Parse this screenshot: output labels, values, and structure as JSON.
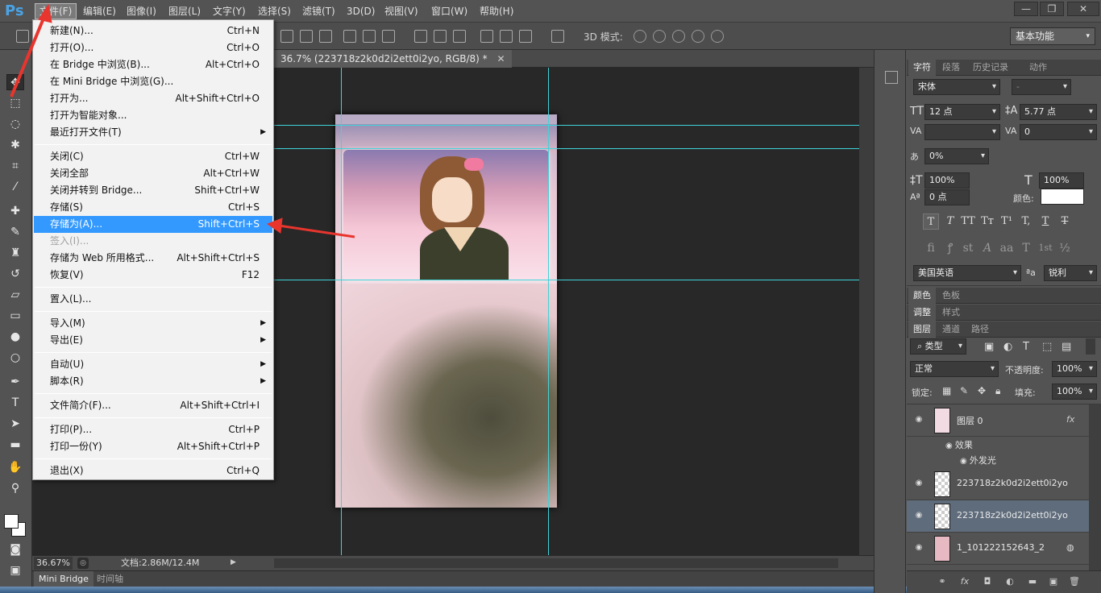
{
  "app": {
    "logo": "Ps"
  },
  "menubar": {
    "items": [
      "文件(F)",
      "编辑(E)",
      "图像(I)",
      "图层(L)",
      "文字(Y)",
      "选择(S)",
      "滤镜(T)",
      "3D(D)",
      "视图(V)",
      "窗口(W)",
      "帮助(H)"
    ],
    "window_buttons": [
      "—",
      "❐",
      "✕"
    ]
  },
  "options": {
    "label_3d": "3D 模式:",
    "workspace": "基本功能"
  },
  "document": {
    "tab_title": "36.7% (223718z2k0d2i2ett0i2yo, RGB/8) *",
    "close": "✕"
  },
  "status": {
    "zoom": "36.67%",
    "doc_size": "文档:2.86M/12.4M"
  },
  "bottom_tabs": [
    "Mini Bridge",
    "时间轴"
  ],
  "file_menu": {
    "groups": [
      [
        {
          "label": "新建(N)...",
          "shortcut": "Ctrl+N"
        },
        {
          "label": "打开(O)...",
          "shortcut": "Ctrl+O"
        },
        {
          "label": "在 Bridge 中浏览(B)...",
          "shortcut": "Alt+Ctrl+O"
        },
        {
          "label": "在 Mini Bridge 中浏览(G)...",
          "shortcut": ""
        },
        {
          "label": "打开为...",
          "shortcut": "Alt+Shift+Ctrl+O"
        },
        {
          "label": "打开为智能对象...",
          "shortcut": ""
        },
        {
          "label": "最近打开文件(T)",
          "shortcut": "",
          "submenu": true
        }
      ],
      [
        {
          "label": "关闭(C)",
          "shortcut": "Ctrl+W"
        },
        {
          "label": "关闭全部",
          "shortcut": "Alt+Ctrl+W"
        },
        {
          "label": "关闭并转到 Bridge...",
          "shortcut": "Shift+Ctrl+W"
        },
        {
          "label": "存储(S)",
          "shortcut": "Ctrl+S"
        },
        {
          "label": "存储为(A)...",
          "shortcut": "Shift+Ctrl+S",
          "highlighted": true
        },
        {
          "label": "签入(I)...",
          "shortcut": "",
          "disabled": true
        },
        {
          "label": "存储为 Web 所用格式...",
          "shortcut": "Alt+Shift+Ctrl+S"
        },
        {
          "label": "恢复(V)",
          "shortcut": "F12"
        }
      ],
      [
        {
          "label": "置入(L)...",
          "shortcut": ""
        }
      ],
      [
        {
          "label": "导入(M)",
          "shortcut": "",
          "submenu": true
        },
        {
          "label": "导出(E)",
          "shortcut": "",
          "submenu": true
        }
      ],
      [
        {
          "label": "自动(U)",
          "shortcut": "",
          "submenu": true
        },
        {
          "label": "脚本(R)",
          "shortcut": "",
          "submenu": true
        }
      ],
      [
        {
          "label": "文件简介(F)...",
          "shortcut": "Alt+Shift+Ctrl+I"
        }
      ],
      [
        {
          "label": "打印(P)...",
          "shortcut": "Ctrl+P"
        },
        {
          "label": "打印一份(Y)",
          "shortcut": "Alt+Shift+Ctrl+P"
        }
      ],
      [
        {
          "label": "退出(X)",
          "shortcut": "Ctrl+Q"
        }
      ]
    ]
  },
  "character_panel": {
    "tabs": [
      "字符",
      "段落",
      "历史记录",
      "动作"
    ],
    "font_family": "宋体",
    "font_style": "-",
    "font_size": "12 点",
    "leading": "5.77 点",
    "kerning": "",
    "tracking": "0",
    "scale_pct": "0%",
    "vertical_scale": "100%",
    "horizontal_scale": "100%",
    "baseline_shift": "0 点",
    "color_label": "颜色:",
    "color_value": "#ffffff",
    "style_buttons": [
      "T",
      "T",
      "TT",
      "Tт",
      "T¹",
      "T,",
      "T",
      "T"
    ],
    "opentype_buttons": [
      "fi",
      "ꝭ",
      "st",
      "A",
      "aa",
      "T",
      "1st",
      "½"
    ],
    "language": "美国英语",
    "aa_label": "ªa",
    "antialias": "锐利"
  },
  "color_tabs": [
    "颜色",
    "色板"
  ],
  "adjust_tabs": [
    "调整",
    "样式"
  ],
  "layers_panel": {
    "tabs": [
      "图层",
      "通道",
      "路径"
    ],
    "filter_kind": "类型",
    "blend_mode": "正常",
    "opacity_label": "不透明度:",
    "opacity": "100%",
    "lock_label": "锁定:",
    "fill_label": "填充:",
    "fill": "100%",
    "layers": [
      {
        "name": "图层 0",
        "fx": "fx",
        "effects_label": "效果",
        "effect": "外发光"
      },
      {
        "name": "223718z2k0d2i2ett0i2yo"
      },
      {
        "name": "223718z2k0d2i2ett0i2yo",
        "selected": true
      },
      {
        "name": "1_101222152643_2"
      }
    ]
  }
}
